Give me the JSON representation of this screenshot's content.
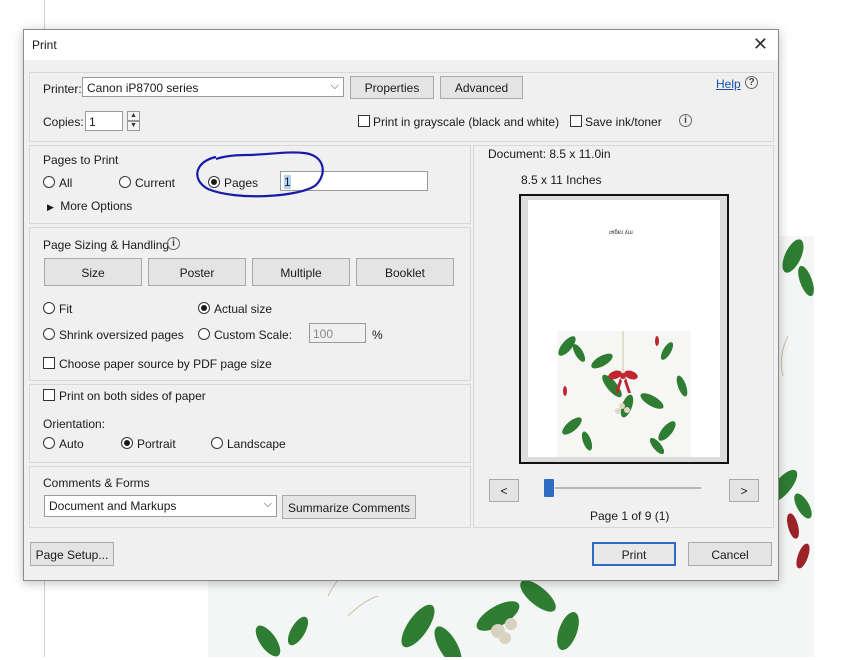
{
  "dialog": {
    "title": "Print",
    "close_label": "✕",
    "help_label": "Help"
  },
  "printer": {
    "label": "Printer:",
    "value": "Canon iP8700 series",
    "properties_label": "Properties",
    "advanced_label": "Advanced",
    "copies_label": "Copies:",
    "copies_value": "1",
    "grayscale_label": "Print in grayscale (black and white)",
    "save_ink_label": "Save ink/toner"
  },
  "pages_to_print": {
    "title": "Pages to Print",
    "all_label": "All",
    "current_label": "Current",
    "pages_label": "Pages",
    "pages_value": "1",
    "more_options_label": "More Options"
  },
  "sizing": {
    "title": "Page Sizing & Handling",
    "size_label": "Size",
    "poster_label": "Poster",
    "multiple_label": "Multiple",
    "booklet_label": "Booklet",
    "fit_label": "Fit",
    "actual_size_label": "Actual size",
    "shrink_label": "Shrink oversized pages",
    "custom_scale_label": "Custom Scale:",
    "custom_scale_value": "100",
    "percent_label": "%",
    "paper_source_label": "Choose paper source by PDF page size"
  },
  "duplex": {
    "both_sides_label": "Print on both sides of paper",
    "orientation_label": "Orientation:",
    "auto_label": "Auto",
    "portrait_label": "Portrait",
    "landscape_label": "Landscape"
  },
  "comments": {
    "title": "Comments & Forms",
    "value": "Document and Markups",
    "summarize_label": "Summarize Comments"
  },
  "preview": {
    "document_size": "Document: 8.5 x 11.0in",
    "paper_size": "8.5 x 11 Inches",
    "page_text": "ꝍᴉƃɐɹ ʎɯ",
    "prev_label": "<",
    "next_label": ">",
    "page_indicator": "Page 1 of 9 (1)",
    "current_page": 1,
    "total_pages": 9
  },
  "footer": {
    "page_setup_label": "Page Setup...",
    "print_label": "Print",
    "cancel_label": "Cancel"
  },
  "colors": {
    "accent": "#2e6cc4",
    "annotation": "#1a1aa8",
    "leaf": "#2e7d32",
    "bow": "#c0262d"
  }
}
